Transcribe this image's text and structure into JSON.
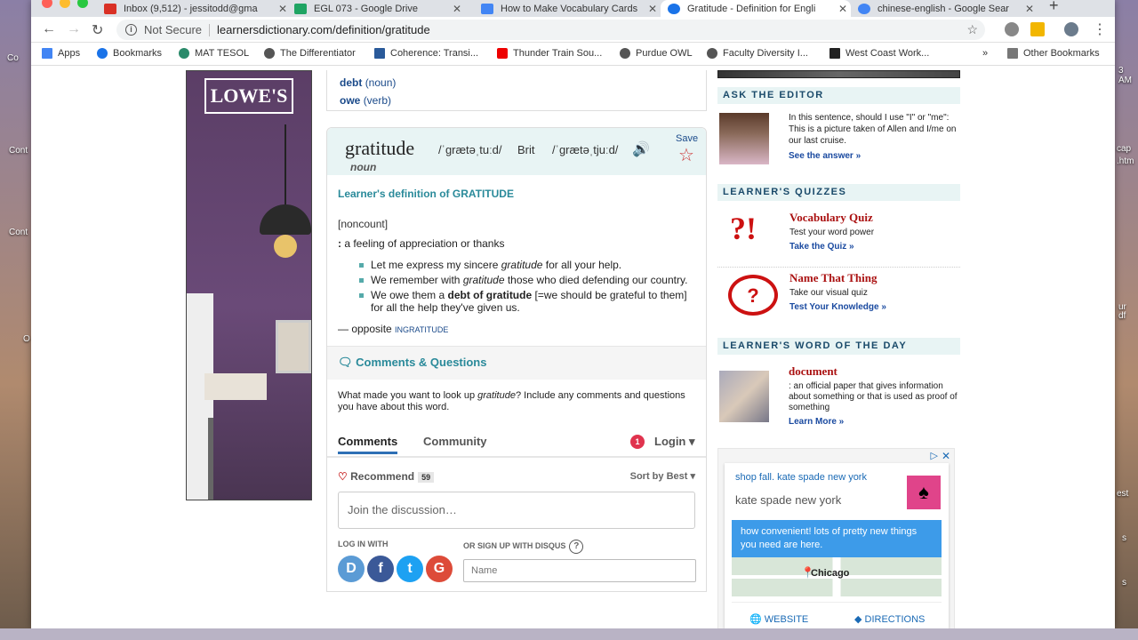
{
  "desktop": {
    "labels": [
      "Co",
      "Cont",
      "Cont",
      "O",
      "cap",
      ".htm",
      "3 AM",
      "ur",
      "df",
      "est",
      "s",
      "s"
    ]
  },
  "tabs": [
    {
      "title": "Inbox (9,512) - jessitodd@gma",
      "icon": "gmail-icon",
      "color": "#d93025"
    },
    {
      "title": "EGL 073 - Google Drive",
      "icon": "drive-icon",
      "color": "#1fa463"
    },
    {
      "title": "How to Make Vocabulary Cards",
      "icon": "docs-icon",
      "color": "#4285f4"
    },
    {
      "title": "Gratitude - Definition for Engli",
      "icon": "globe-icon",
      "color": "#1a73e8"
    },
    {
      "title": "chinese-english - Google Sear",
      "icon": "google-icon",
      "color": "#4285f4"
    }
  ],
  "omnibox": {
    "security": "Not Secure",
    "url": "learnersdictionary.com/definition/gratitude"
  },
  "bookmarks": [
    {
      "label": "Apps",
      "icon": "apps-grid-icon"
    },
    {
      "label": "Bookmarks",
      "icon": "star-icon"
    },
    {
      "label": "MAT TESOL",
      "icon": "globe-icon"
    },
    {
      "label": "The Differentiator",
      "icon": "globe-icon"
    },
    {
      "label": "Coherence: Transi...",
      "icon": "c-icon"
    },
    {
      "label": "Thunder Train Sou...",
      "icon": "youtube-icon"
    },
    {
      "label": "Purdue OWL",
      "icon": "globe-icon"
    },
    {
      "label": "Faculty Diversity I...",
      "icon": "globe-icon"
    },
    {
      "label": "West Coast Work...",
      "icon": "w-icon"
    }
  ],
  "other_bookmarks": "Other Bookmarks",
  "ad_left": {
    "brand": "LOWE'S"
  },
  "related": [
    {
      "word": "debt",
      "pos": "(noun)"
    },
    {
      "word": "owe",
      "pos": "(verb)"
    }
  ],
  "entry": {
    "headword": "gratitude",
    "pos": "noun",
    "pron_us": "/ˈgrætəˌtuːd/",
    "brit_label": "Brit",
    "pron_brit": "/ˈgrætəˌtjuːd/",
    "save_label": "Save",
    "learner_def_heading": "Learner's definition of GRATITUDE",
    "grammar": "[noncount]",
    "sense_colon": ":",
    "sense": "a feeling of appreciation or thanks",
    "examples": [
      {
        "pre": "Let me express my sincere ",
        "em": "gratitude",
        "post": " for all your help."
      },
      {
        "pre": "We remember with ",
        "em": "gratitude",
        "post": " those who died defending our country."
      },
      {
        "pre": "We owe them a ",
        "bold": "debt of gratitude",
        "post": " [=we should be grateful to them] for all the help they've given us."
      }
    ],
    "opposite_prefix": "— opposite",
    "opposite_word": "INGRATITUDE"
  },
  "comments": {
    "heading": "Comments & Questions",
    "prompt_pre": "What made you want to look up ",
    "prompt_em": "gratitude",
    "prompt_post": "? Include any comments and questions you have about this word.",
    "tab_comments": "Comments",
    "tab_community": "Community",
    "login_badge": "1",
    "login_label": "Login",
    "recommend_label": "Recommend",
    "recommend_count": "59",
    "sort_label": "Sort by Best",
    "join_placeholder": "Join the discussion…",
    "login_with": "LOG IN WITH",
    "signup_disqus": "OR SIGN UP WITH DISQUS",
    "name_placeholder": "Name"
  },
  "sidebar": {
    "ask_editor_heading": "ASK THE EDITOR",
    "ask_editor_text": "In this sentence, should I use \"I\" or \"me\": This is a picture taken of Allen and I/me on our last cruise.",
    "ask_editor_link": "See the answer »",
    "quizzes_heading": "LEARNER'S QUIZZES",
    "quiz1": {
      "title": "Vocabulary Quiz",
      "sub": "Test your word power",
      "link": "Take the Quiz »"
    },
    "quiz2": {
      "title": "Name That Thing",
      "sub": "Take our visual quiz",
      "link": "Test Your Knowledge »"
    },
    "wotd_heading": "LEARNER'S WORD OF THE DAY",
    "wotd_word": "document",
    "wotd_def": ": an official paper that gives information about something or that is used as proof of something",
    "wotd_link": "Learn More »"
  },
  "ad_right": {
    "title": "shop fall. kate spade new york",
    "sub": "kate spade new york",
    "bubble": "how convenient! lots of pretty new things you need are here.",
    "city": "Chicago",
    "website": "WEBSITE",
    "directions": "DIRECTIONS"
  }
}
